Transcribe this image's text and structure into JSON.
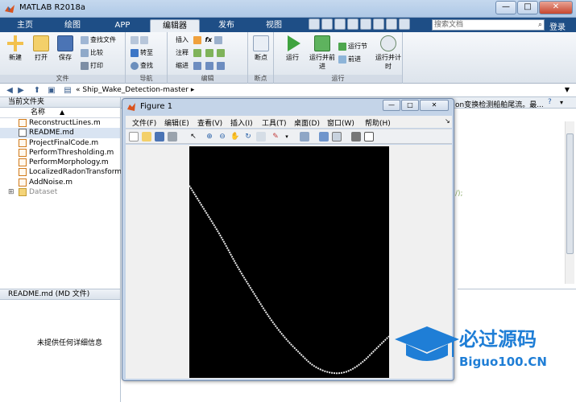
{
  "window": {
    "title": "MATLAB R2018a",
    "min": "—",
    "max": "□",
    "close": "✕"
  },
  "tabs": [
    {
      "label": "主页"
    },
    {
      "label": "绘图"
    },
    {
      "label": "APP"
    },
    {
      "label": "编辑器"
    },
    {
      "label": "发布"
    },
    {
      "label": "视图"
    }
  ],
  "search": {
    "placeholder": "搜索文档"
  },
  "login": "登录",
  "ribbon": {
    "file_group": {
      "label": "文件",
      "new": "新建",
      "open": "打开",
      "save": "保存",
      "find_files": "查找文件",
      "compare": "比较",
      "print": "打印"
    },
    "nav_group": {
      "label": "导航",
      "goto": "转至",
      "find": "查找"
    },
    "edit_group": {
      "label": "编辑",
      "insert": "插入",
      "comment": "注释",
      "indent": "缩进",
      "fx": "fx"
    },
    "breakpoint_group": {
      "label": "断点",
      "breakpoints": "断点"
    },
    "run_group": {
      "label": "运行",
      "run": "运行",
      "run_advance": "运行并前进",
      "run_section": "运行节",
      "advance": "前进",
      "run_time": "运行并计时"
    }
  },
  "address": {
    "path": "Ship_Wake_Detection-master",
    "prefix": "«"
  },
  "current_folder": {
    "title": "当前文件夹",
    "column": "名称",
    "sort": "▲",
    "files": [
      {
        "name": "ReconstructLines.m",
        "type": "m"
      },
      {
        "name": "README.md",
        "type": "doc"
      },
      {
        "name": "ProjectFinalCode.m",
        "type": "m"
      },
      {
        "name": "PerformThresholding.m",
        "type": "m"
      },
      {
        "name": "PerformMorphology.m",
        "type": "m"
      },
      {
        "name": "LocalizedRadonTransform.m",
        "type": "m"
      },
      {
        "name": "AddNoise.m",
        "type": "m"
      },
      {
        "name": "Dataset",
        "type": "folder"
      }
    ]
  },
  "details": {
    "title": "README.md  (MD 文件)",
    "message": "未提供任何详细信息"
  },
  "editor": {
    "tab_text": "on变换检测船舶尾流。最...",
    "code_fragment": "/);"
  },
  "figure": {
    "title": "Figure 1",
    "menus": [
      "文件(F)",
      "编辑(E)",
      "查看(V)",
      "插入(I)",
      "工具(T)",
      "桌面(D)",
      "窗口(W)",
      "帮助(H)"
    ],
    "curve_color": "#e8e8e8",
    "curve_points": [
      [
        0,
        0.17
      ],
      [
        0.08,
        0.28
      ],
      [
        0.16,
        0.39
      ],
      [
        0.24,
        0.52
      ],
      [
        0.32,
        0.63
      ],
      [
        0.4,
        0.74
      ],
      [
        0.48,
        0.83
      ],
      [
        0.56,
        0.9
      ],
      [
        0.62,
        0.95
      ],
      [
        0.7,
        0.98
      ],
      [
        0.78,
        0.98
      ],
      [
        0.86,
        0.94
      ],
      [
        0.94,
        0.87
      ],
      [
        1.0,
        0.82
      ]
    ]
  },
  "watermark": {
    "title": "必过源码",
    "site": "Biguo100.CN"
  }
}
